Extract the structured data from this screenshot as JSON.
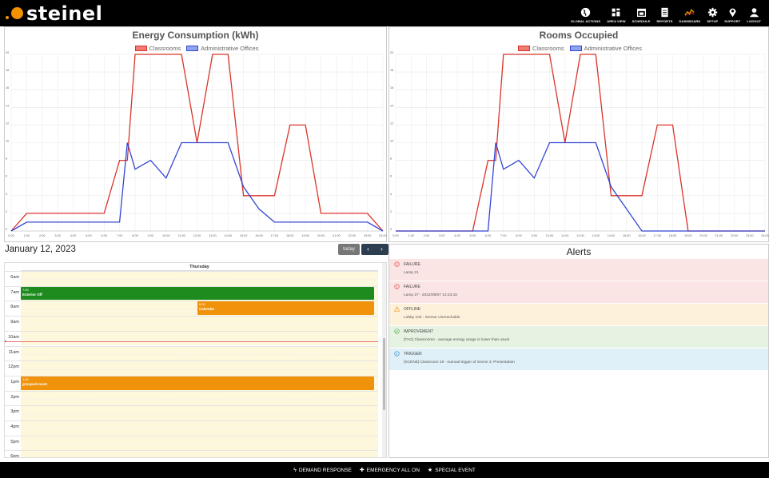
{
  "logo": {
    "text": "steinel"
  },
  "nav": [
    {
      "label": "GLOBAL ACTIONS",
      "icon": "globe-icon"
    },
    {
      "label": "AREA VIEW",
      "icon": "grid-icon"
    },
    {
      "label": "SCHEDULE",
      "icon": "calendar-icon"
    },
    {
      "label": "REPORTS",
      "icon": "document-icon"
    },
    {
      "label": "DASHBOARD",
      "icon": "chart-icon"
    },
    {
      "label": "SETUP",
      "icon": "gear-icon"
    },
    {
      "label": "SUPPORT",
      "icon": "marker-icon"
    },
    {
      "label": "LOGOUT",
      "icon": "user-icon"
    }
  ],
  "chart_data": [
    {
      "type": "line",
      "title": "Energy Consumption (kWh)",
      "x": [
        "0:00",
        "1:00",
        "2:00",
        "3:00",
        "4:00",
        "5:00",
        "6:00",
        "7:00",
        "8:00",
        "9:00",
        "10:00",
        "11:00",
        "12:00",
        "13:00",
        "14:00",
        "15:00",
        "16:00",
        "17:00",
        "18:00",
        "19:00",
        "20:00",
        "21:00",
        "22:00",
        "23:00"
      ],
      "xticks": [
        "0:00",
        "1:00",
        "2:00",
        "3:00",
        "4:00",
        "5:00",
        "6:00",
        "7:00",
        "8:00",
        "9:00",
        "10:00",
        "11:00",
        "12:00",
        "13:00",
        "14:00",
        "15:00",
        "16:00",
        "17:00",
        "18:00",
        "19:00",
        "20:00",
        "21:00",
        "22:00",
        "23:00",
        "24:00"
      ],
      "ylim": [
        0,
        20
      ],
      "yticks": [
        "0",
        "2",
        "4",
        "6",
        "8",
        "10",
        "12",
        "14",
        "16",
        "18",
        "20"
      ],
      "series": [
        {
          "name": "Classrooms",
          "color": "#d9342b",
          "fill": "#ef7b72",
          "x": [
            0,
            1,
            2,
            3,
            4,
            5,
            6,
            7,
            7.5,
            8,
            9,
            10,
            11,
            12,
            13,
            14,
            15,
            16,
            17,
            18,
            19,
            20,
            21,
            22,
            23,
            24
          ],
          "y": [
            0,
            2,
            2,
            2,
            2,
            2,
            2,
            8,
            8,
            20,
            20,
            20,
            20,
            10,
            20,
            20,
            4,
            4,
            4,
            12,
            12,
            2,
            2,
            2,
            2,
            0
          ]
        },
        {
          "name": "Administrative Offices",
          "color": "#3346d3",
          "fill": "#8fa3ee",
          "x": [
            0,
            1,
            2,
            3,
            4,
            5,
            6,
            7,
            7.5,
            8,
            9,
            10,
            11,
            12,
            13,
            14,
            15,
            16,
            17,
            18,
            19,
            20,
            21,
            22,
            23,
            24
          ],
          "y": [
            0,
            1,
            1,
            1,
            1,
            1,
            1,
            1,
            10,
            7,
            8,
            6,
            10,
            10,
            10,
            10,
            5,
            2.5,
            1,
            1,
            1,
            1,
            1,
            1,
            1,
            0
          ]
        }
      ]
    },
    {
      "type": "line",
      "title": "Rooms Occupied",
      "x": [
        "0:00",
        "1:00",
        "2:00",
        "3:00",
        "4:00",
        "5:00",
        "6:00",
        "7:00",
        "8:00",
        "9:00",
        "10:00",
        "11:00",
        "12:00",
        "13:00",
        "14:00",
        "15:00",
        "16:00",
        "17:00",
        "18:00",
        "19:00",
        "20:00",
        "21:00",
        "22:00",
        "23:00"
      ],
      "xticks": [
        "0:00",
        "1:00",
        "2:00",
        "3:00",
        "4:00",
        "5:00",
        "6:00",
        "7:00",
        "8:00",
        "9:00",
        "10:00",
        "11:00",
        "12:00",
        "13:00",
        "14:00",
        "15:00",
        "16:00",
        "17:00",
        "18:00",
        "19:00",
        "20:00",
        "21:00",
        "22:00",
        "23:00",
        "24:00"
      ],
      "ylim": [
        0,
        20
      ],
      "yticks": [
        "0",
        "2",
        "4",
        "6",
        "8",
        "10",
        "12",
        "14",
        "16",
        "18",
        "20"
      ],
      "series": [
        {
          "name": "Classrooms",
          "color": "#d9342b",
          "fill": "#ef7b72",
          "x": [
            0,
            5,
            5,
            6,
            6.5,
            7,
            8,
            9,
            10,
            11,
            12,
            13,
            14,
            15,
            16,
            17,
            18,
            19,
            20,
            21,
            22,
            23,
            24
          ],
          "y": [
            0,
            0,
            0,
            8,
            8,
            20,
            20,
            20,
            20,
            10,
            20,
            20,
            4,
            4,
            4,
            12,
            12,
            0,
            0,
            0,
            0,
            0,
            0
          ]
        },
        {
          "name": "Administrative Offices",
          "color": "#3346d3",
          "fill": "#8fa3ee",
          "x": [
            0,
            6,
            6.5,
            7,
            8,
            9,
            10,
            11,
            12,
            13,
            14,
            15,
            16,
            17,
            18,
            19,
            20,
            21,
            22,
            23,
            24
          ],
          "y": [
            0,
            0,
            10,
            7,
            8,
            6,
            10,
            10,
            10,
            10,
            5,
            2.5,
            0,
            0,
            0,
            0,
            0,
            0,
            0,
            0,
            0
          ]
        }
      ]
    }
  ],
  "calendar": {
    "date": "January 12, 2023",
    "today_label": "today",
    "prev_label": "‹",
    "next_label": "›",
    "day_header": "Thursday",
    "hours": [
      "6am",
      "7am",
      "8am",
      "9am",
      "10am",
      "11am",
      "12pm",
      "1pm",
      "2pm",
      "3pm",
      "4pm",
      "5pm",
      "6pm"
    ],
    "events": [
      {
        "time": "7:00",
        "title": "Exterior Off",
        "color": "#1e8b1e",
        "start": 7.0,
        "end": 8.0,
        "col_start": 0,
        "col_end": 1
      },
      {
        "time": "8:00",
        "title": "Calendar",
        "color": "#f0930a",
        "start": 8.0,
        "end": 9.0,
        "col_start": 0.5,
        "col_end": 1
      },
      {
        "time": "1:00",
        "title": "grouped event",
        "color": "#f0930a",
        "start": 13.0,
        "end": 14.0,
        "col_start": 0,
        "col_end": 1
      }
    ],
    "now_hour": 10.7
  },
  "alerts": {
    "title": "Alerts",
    "items": [
      {
        "type": "FAILURE",
        "message": "Lamp 21",
        "bg": "#fbe4e4",
        "icon_color": "#e05050",
        "icon": "error-icon"
      },
      {
        "type": "FAILURE",
        "message": "Lamp 27 - 2022/09/07 12:43:16",
        "bg": "#fbe4e4",
        "icon_color": "#e05050",
        "icon": "error-icon"
      },
      {
        "type": "OFFLINE",
        "message": "Lobby 103 - Sensor Unreachable",
        "bg": "#fdf1dc",
        "icon_color": "#e9a23b",
        "icon": "warning-icon"
      },
      {
        "type": "IMPROVEMENT",
        "message": "[TAG] Classrooms - average energy usage is lower than usual",
        "bg": "#e6f3e3",
        "icon_color": "#5cae5c",
        "icon": "check-icon"
      },
      {
        "type": "TRIGGER",
        "message": "[SCENE] Classroom 18 - manual trigger of Scene 4: Presentation",
        "bg": "#e0f0f8",
        "icon_color": "#3a8fd0",
        "icon": "info-icon"
      }
    ]
  },
  "footer": [
    {
      "label": "DEMAND RESPONSE",
      "icon": "bolt-icon"
    },
    {
      "label": "EMERGENCY ALL ON",
      "icon": "emergency-icon"
    },
    {
      "label": "SPECIAL EVENT",
      "icon": "star-icon"
    }
  ]
}
